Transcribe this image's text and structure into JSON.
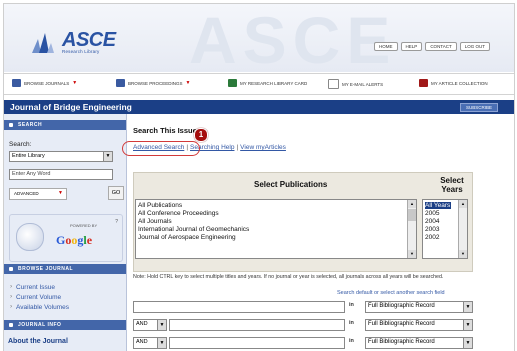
{
  "header": {
    "logo_text": "ASCE",
    "logo_sub": "Research Library",
    "watermark": "ASCE",
    "top_links": [
      "HOME",
      "HELP",
      "CONTACT",
      "LOG OUT"
    ]
  },
  "nav": {
    "items": [
      {
        "label": "BROWSE JOURNALS",
        "color": "#3a5aa0"
      },
      {
        "label": "BROWSE PROCEEDINGS",
        "color": "#3a5aa0"
      },
      {
        "label": "MY RESEARCH LIBRARY CARD",
        "color": "#2b7a3a"
      },
      {
        "label": "MY E-MAIL ALERTS",
        "color": "#888888"
      },
      {
        "label": "MY ARTICLE COLLECTION",
        "color": "#a01818"
      }
    ]
  },
  "titlebar": {
    "title": "Journal of Bridge Engineering",
    "subscribe": "SUBSCRIBE"
  },
  "sidebar": {
    "search_head": "SEARCH",
    "search_label": "Search:",
    "scope_value": "Entire Library",
    "keyword_placeholder": "Enter Any Word",
    "advanced_label": "ADVANCED",
    "go_label": "GO",
    "powered_by": "POWERED BY",
    "google_text": "Google",
    "browse_head": "BROWSE JOURNAL",
    "browse_links": [
      "Current Issue",
      "Current Volume",
      "Available Volumes"
    ],
    "journal_info_head": "JOURNAL INFO",
    "about": "About the Journal"
  },
  "main": {
    "search_title": "Search This Issue",
    "links": {
      "advanced": "Advanced Search",
      "help": "Searching Help",
      "articles": "View myArticles",
      "separator": "|"
    },
    "callout_number": "1",
    "select_publications": "Select Publications",
    "select_years": "Select Years",
    "publications": [
      "All Publications",
      "All Conference Proceedings",
      "All Journals",
      "International Journal of Geomechanics",
      "Journal of Aerospace Engineering"
    ],
    "years": [
      "All Years",
      "2005",
      "2004",
      "2003",
      "2002"
    ],
    "note": "Note: Hold CTRL key to select multiple titles and years. If no journal or year is selected, all journals across all years will be searched.",
    "search_default": "Search default or select another search field",
    "in_label": "in",
    "operators": [
      "AND",
      "AND"
    ],
    "fields": [
      "Full Bibliographic Record",
      "Full Bibliographic Record",
      "Full Bibliographic Record"
    ]
  }
}
